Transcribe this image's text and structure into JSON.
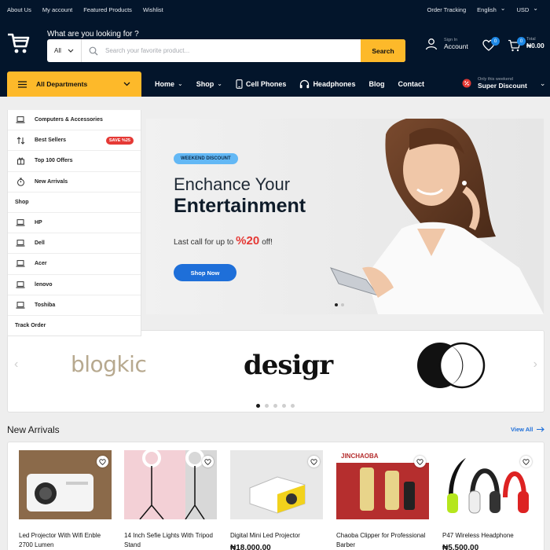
{
  "topbar": {
    "left_links": [
      "About Us",
      "My account",
      "Featured Products",
      "Wishlist"
    ],
    "order_tracking": "Order Tracking",
    "language": "English",
    "currency": "USD"
  },
  "header": {
    "tagline": "What are you looking for ?",
    "search": {
      "category": "All",
      "placeholder": "Search your favorite product...",
      "button": "Search"
    },
    "account": {
      "small": "Sign In",
      "label": "Account"
    },
    "wishlist_count": "0",
    "cart_count": "0",
    "cart_total": {
      "small": "Total",
      "amount": "₦0.00"
    }
  },
  "nav": {
    "all_departments": "All Departments",
    "links": [
      {
        "label": "Home",
        "dropdown": true
      },
      {
        "label": "Shop",
        "dropdown": true
      },
      {
        "label": "Cell Phones",
        "icon": "phone-icon"
      },
      {
        "label": "Headphones",
        "icon": "headphones-icon"
      },
      {
        "label": "Blog"
      },
      {
        "label": "Contact"
      }
    ],
    "super_discount": {
      "small": "Only this weekend",
      "label": "Super Discount"
    }
  },
  "sidebar": {
    "items": [
      {
        "label": "Computers & Accessories",
        "icon": "laptop-icon"
      },
      {
        "label": "Best Sellers",
        "icon": "sort-icon",
        "badge": "SAVE %25"
      },
      {
        "label": "Top 100 Offers",
        "icon": "gift-icon"
      },
      {
        "label": "New Arrivals",
        "icon": "stopwatch-icon"
      },
      {
        "label": "Shop",
        "heading": true
      },
      {
        "label": "HP",
        "icon": "laptop-icon"
      },
      {
        "label": "Dell",
        "icon": "laptop-icon"
      },
      {
        "label": "Acer",
        "icon": "laptop-icon"
      },
      {
        "label": "lenovo",
        "icon": "laptop-icon"
      },
      {
        "label": "Toshiba",
        "icon": "laptop-icon"
      },
      {
        "label": "Track Order",
        "heading": true
      }
    ]
  },
  "hero": {
    "pill": "WEEKEND DISCOUNT",
    "line1": "Enchance Your",
    "line2": "Entertainment",
    "call_prefix": "Last call for up to",
    "call_pct": "%20",
    "call_suffix": "off!",
    "button": "Shop Now",
    "slide_count": 2,
    "active_slide": 0
  },
  "brands": {
    "logos": [
      "blogkic",
      "desigr"
    ],
    "dot_count": 5,
    "active_dot": 0
  },
  "new_arrivals": {
    "title": "New Arrivals",
    "view_all": "View All",
    "products": [
      {
        "name": "Led Projector With Wifi Enble 2700 Lumen",
        "price": ""
      },
      {
        "name": "14 Inch Sefie Lights With Tripod Stand",
        "price": ""
      },
      {
        "name": "Digital Mini Led Projector",
        "price": "₦18,000.00"
      },
      {
        "name": "Chaoba Clipper for Professional Barber",
        "price": ""
      },
      {
        "name": "P47 Wireless Headphone",
        "price": "₦5,500.00"
      }
    ],
    "product_label": "JINCHAOBA"
  },
  "colors": {
    "navy": "#03152b",
    "accent": "#fdb92a",
    "blue": "#1e6fd9",
    "sale": "#e53935"
  }
}
